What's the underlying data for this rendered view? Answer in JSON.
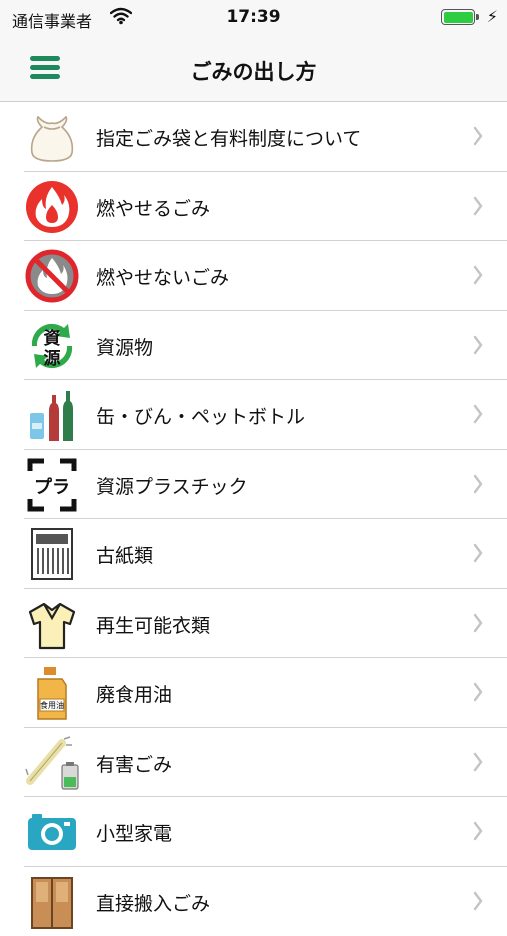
{
  "status_bar": {
    "carrier": "通信事業者",
    "time": "17:39",
    "wifi_icon": "wifi-icon",
    "battery_icon": "battery-icon",
    "charging_icon": "charging-bolt-icon",
    "battery_color": "#2ecc40"
  },
  "nav": {
    "title": "ごみの出し方",
    "menu_icon": "hamburger-menu-icon",
    "accent_color": "#1d8a5e"
  },
  "items": [
    {
      "label": "指定ごみ袋と有料制度について",
      "icon": "garbage-bag-icon"
    },
    {
      "label": "燃やせるごみ",
      "icon": "flame-icon"
    },
    {
      "label": "燃やせないごみ",
      "icon": "no-burn-icon"
    },
    {
      "label": "資源物",
      "icon": "recycle-resources-icon",
      "icon_text_top": "資",
      "icon_text_bottom": "源"
    },
    {
      "label": "缶・びん・ペットボトル",
      "icon": "cans-bottles-icon"
    },
    {
      "label": "資源プラスチック",
      "icon": "plastic-recycle-mark-icon",
      "icon_text": "プラ"
    },
    {
      "label": "古紙類",
      "icon": "newspaper-icon"
    },
    {
      "label": "再生可能衣類",
      "icon": "shirt-icon"
    },
    {
      "label": "廃食用油",
      "icon": "cooking-oil-icon",
      "icon_text": "食用油"
    },
    {
      "label": "有害ごみ",
      "icon": "hazardous-battery-icon"
    },
    {
      "label": "小型家電",
      "icon": "camera-icon"
    },
    {
      "label": "直接搬入ごみ",
      "icon": "furniture-icon"
    }
  ]
}
